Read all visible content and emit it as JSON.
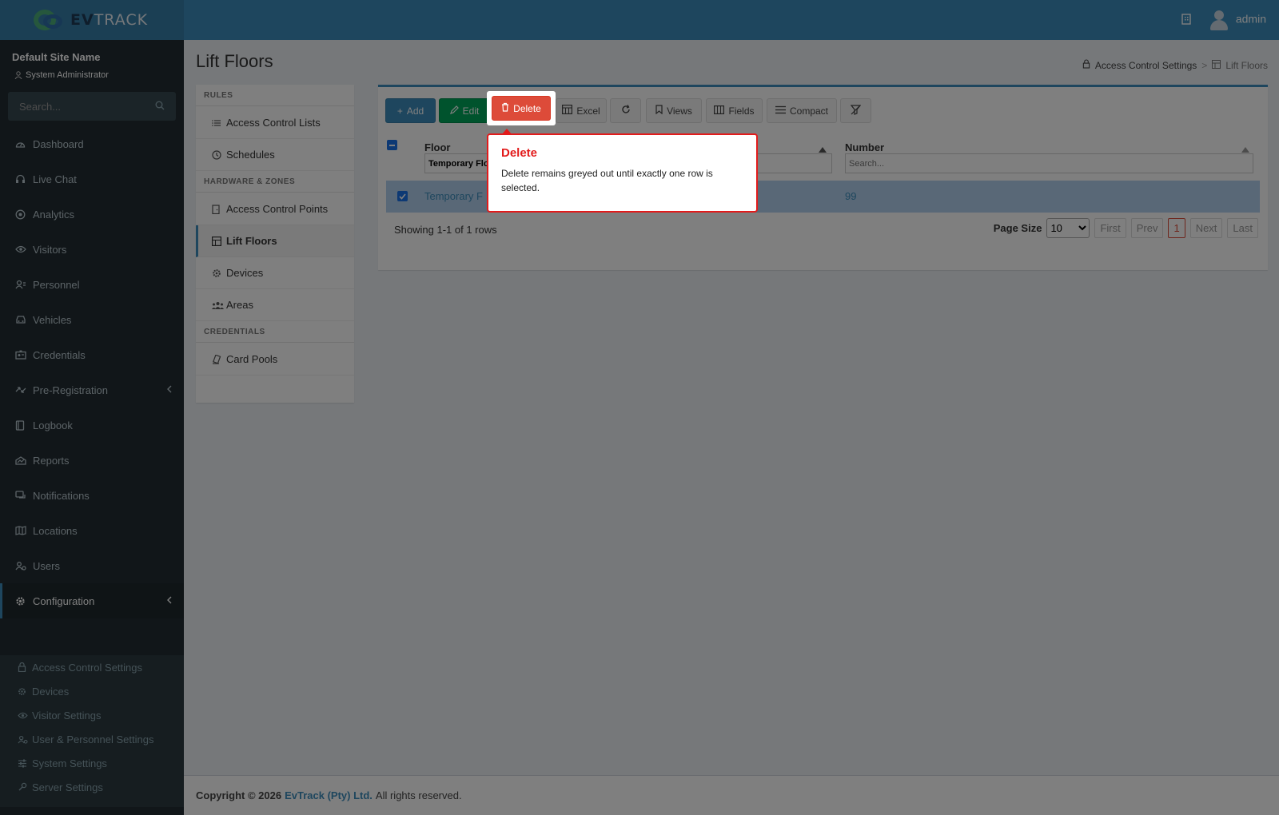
{
  "app": {
    "logo_ev": "EV",
    "logo_track": "TRACK"
  },
  "topbar": {
    "user": "admin"
  },
  "sidebar": {
    "site_name": "Default Site Name",
    "role": "System Administrator",
    "search_placeholder": "Search...",
    "items": [
      {
        "label": "Dashboard",
        "icon": "dashboard-icon"
      },
      {
        "label": "Live Chat",
        "icon": "headset-icon"
      },
      {
        "label": "Analytics",
        "icon": "target-icon"
      },
      {
        "label": "Visitors",
        "icon": "eye-icon"
      },
      {
        "label": "Personnel",
        "icon": "personnel-icon"
      },
      {
        "label": "Vehicles",
        "icon": "car-icon"
      },
      {
        "label": "Credentials",
        "icon": "id-card-icon"
      },
      {
        "label": "Pre-Registration",
        "icon": "arrows-icon"
      },
      {
        "label": "Logbook",
        "icon": "book-icon"
      },
      {
        "label": "Reports",
        "icon": "chart-icon"
      },
      {
        "label": "Notifications",
        "icon": "chat-icon"
      },
      {
        "label": "Locations",
        "icon": "map-icon"
      },
      {
        "label": "Users",
        "icon": "users-icon"
      },
      {
        "label": "Configuration",
        "icon": "gear-icon"
      }
    ],
    "submenu": [
      {
        "label": "Access Control Settings",
        "icon": "lock-icon"
      },
      {
        "label": "Devices",
        "icon": "gear-icon"
      },
      {
        "label": "Visitor Settings",
        "icon": "eye-icon"
      },
      {
        "label": "User & Personnel Settings",
        "icon": "users-icon"
      },
      {
        "label": "System Settings",
        "icon": "sliders-icon"
      },
      {
        "label": "Server Settings",
        "icon": "server-icon"
      }
    ]
  },
  "page": {
    "title": "Lift Floors",
    "breadcrumb": {
      "parent": "Access Control Settings",
      "separator": ">",
      "current": "Lift Floors"
    }
  },
  "settings_panel": {
    "sections": [
      {
        "header": "RULES",
        "items": [
          "Access Control Lists",
          "Schedules"
        ]
      },
      {
        "header": "HARDWARE & ZONES",
        "items": [
          "Access Control Points",
          "Lift Floors",
          "Devices",
          "Areas"
        ]
      },
      {
        "header": "CREDENTIALS",
        "items": [
          "Card Pools"
        ]
      }
    ],
    "active_item": "Lift Floors"
  },
  "toolbar": {
    "add": "Add",
    "edit": "Edit",
    "delete": "Delete",
    "excel": "Excel",
    "views": "Views",
    "fields": "Fields",
    "compact": "Compact"
  },
  "table": {
    "columns": [
      "Floor",
      "Number"
    ],
    "filters": {
      "floor": "Temporary Flo",
      "number_placeholder": "Search..."
    },
    "rows": [
      {
        "floor": "Temporary F",
        "number": "99",
        "selected": true
      }
    ],
    "showing": "Showing 1-1 of 1 rows",
    "page_size_label": "Page Size",
    "page_size": "10",
    "pager": {
      "first": "First",
      "prev": "Prev",
      "current": "1",
      "next": "Next",
      "last": "Last"
    }
  },
  "tooltip": {
    "title": "Delete",
    "body": "Delete remains greyed out until exactly one row is selected."
  },
  "footer": {
    "copyright": "Copyright © 2026",
    "company": "EvTrack (Pty) Ltd.",
    "rights": "All rights reserved."
  },
  "colors": {
    "topbar": "#3c8dbc",
    "sidebar": "#222d32",
    "add": "#3c8dbc",
    "edit": "#00a65a",
    "delete": "#dd4b39",
    "tooltip_border": "#e21b1b"
  }
}
